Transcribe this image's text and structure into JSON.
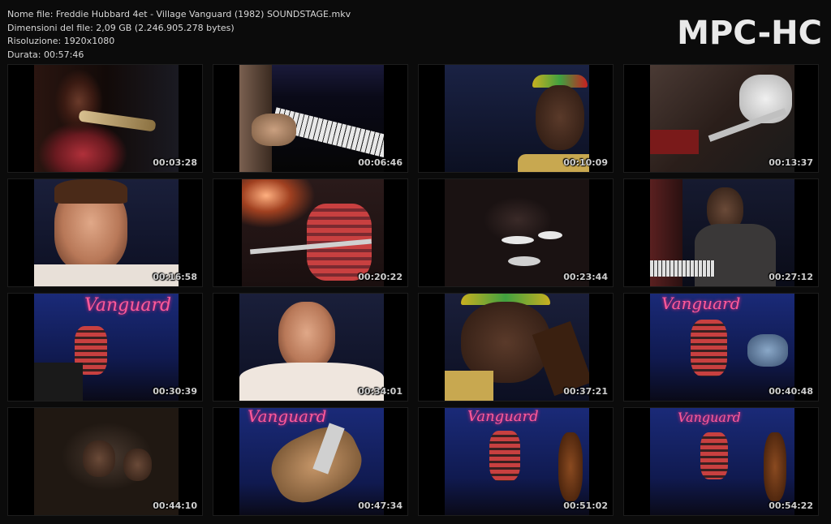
{
  "header": {
    "line1": "Nome file: Freddie Hubbard  4et - Village Vanguard (1982) SOUNDSTAGE.mkv",
    "line2": "Dimensioni del file: 2,09 GB (2.246.905.278 bytes)",
    "line3": "Risoluzione: 1920x1080",
    "line4": "Durata: 00:57:46"
  },
  "logo": "MPC-HC",
  "sign_text": "Vanguard",
  "thumbnails": [
    {
      "time": "00:03:28"
    },
    {
      "time": "00:06:46"
    },
    {
      "time": "00:10:09"
    },
    {
      "time": "00:13:37"
    },
    {
      "time": "00:16:58"
    },
    {
      "time": "00:20:22"
    },
    {
      "time": "00:23:44"
    },
    {
      "time": "00:27:12"
    },
    {
      "time": "00:30:39"
    },
    {
      "time": "00:34:01"
    },
    {
      "time": "00:37:21"
    },
    {
      "time": "00:40:48"
    },
    {
      "time": "00:44:10"
    },
    {
      "time": "00:47:34"
    },
    {
      "time": "00:51:02"
    },
    {
      "time": "00:54:22"
    }
  ]
}
